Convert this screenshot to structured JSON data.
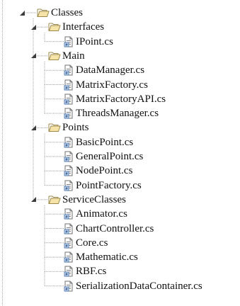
{
  "tree": {
    "root": {
      "label": "Classes",
      "folders": [
        {
          "label": "Interfaces",
          "files": [
            "IPoint.cs"
          ]
        },
        {
          "label": "Main",
          "files": [
            "DataManager.cs",
            "MatrixFactory.cs",
            "MatrixFactoryAPI.cs",
            "ThreadsManager.cs"
          ]
        },
        {
          "label": "Points",
          "files": [
            "BasicPoint.cs",
            "GeneralPoint.cs",
            "NodePoint.cs",
            "PointFactory.cs"
          ]
        },
        {
          "label": "ServiceClasses",
          "files": [
            "Animator.cs",
            "ChartController.cs",
            "Core.cs",
            "Mathematic.cs",
            "RBF.cs",
            "SerializationDataContainer.cs"
          ]
        }
      ]
    },
    "icons": {
      "expanded": "expanded-triangle-icon",
      "folder": "open-folder-icon",
      "file": "csharp-file-icon"
    },
    "colors": {
      "folder_fill": "#f5e3a7",
      "folder_stroke": "#9d8a4b",
      "line": "#a0a0a0",
      "text": "#111111"
    }
  }
}
